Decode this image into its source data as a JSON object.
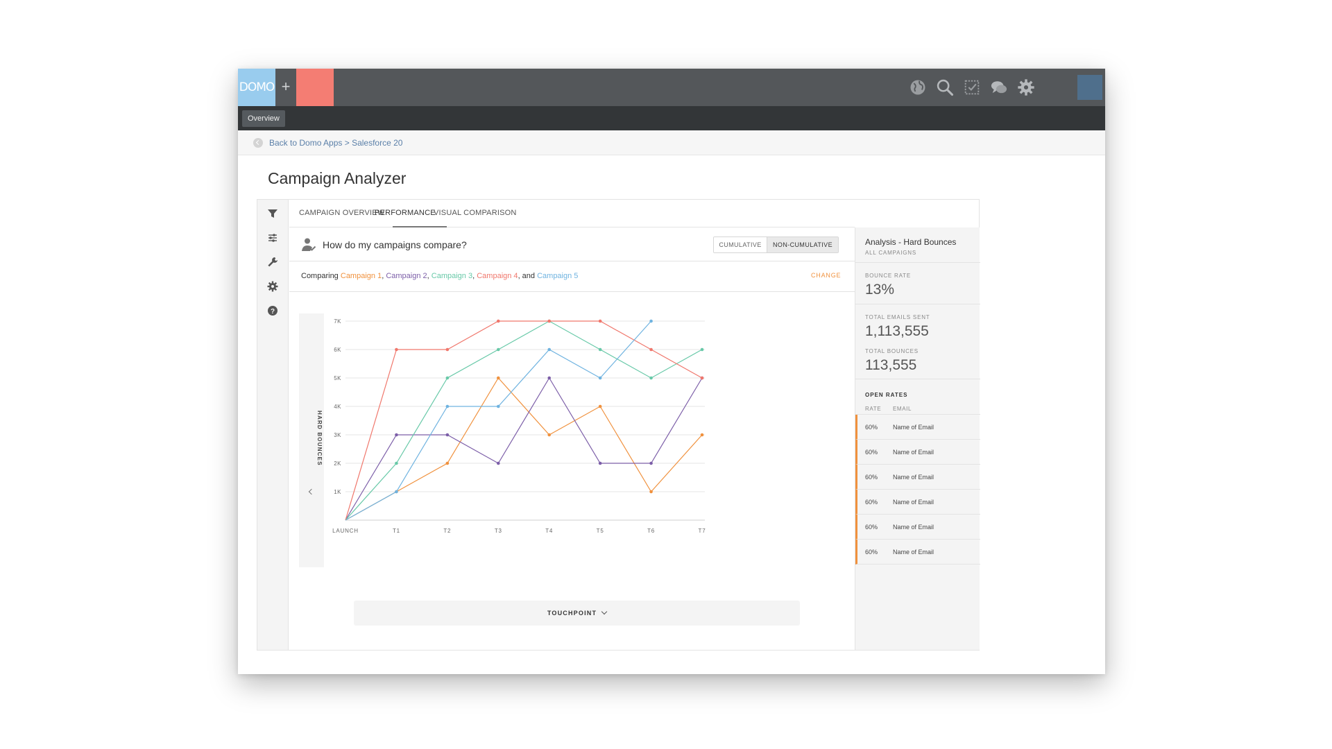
{
  "topbar": {
    "logo_text": "DOMO",
    "plus_label": "+",
    "icons": [
      "globe-icon",
      "search-icon",
      "checkbox-icon",
      "chat-icon",
      "gear-icon"
    ]
  },
  "nav": {
    "active_tab": "Overview"
  },
  "breadcrumb": {
    "text": "Back to Domo Apps > Salesforce 20"
  },
  "page": {
    "title": "Campaign Analyzer"
  },
  "left_rail": {
    "icons": [
      "filter-icon",
      "sliders-icon",
      "wrench-icon",
      "gear-icon",
      "help-icon"
    ]
  },
  "tabs": [
    {
      "label": "CAMPAIGN OVERVIEW",
      "active": false
    },
    {
      "label": "PERFORMANCE",
      "active": true
    },
    {
      "label": "VISUAL COMPARISON",
      "active": false
    }
  ],
  "question": {
    "text": "How do my campaigns compare?"
  },
  "toggle": {
    "option_left": "CUMULATIVE",
    "option_right": "NON-CUMULATIVE",
    "selected": "NON-CUMULATIVE"
  },
  "comparing": {
    "prefix": "Comparing",
    "separator": ", ",
    "and": ", and",
    "campaigns": [
      {
        "name": "Campaign 1",
        "color": "#f0913d"
      },
      {
        "name": "Campaign 2",
        "color": "#7c5ea8"
      },
      {
        "name": "Campaign 3",
        "color": "#68c9a8"
      },
      {
        "name": "Campaign 4",
        "color": "#f0776c"
      },
      {
        "name": "Campaign 5",
        "color": "#6fb3e0"
      }
    ],
    "change_label": "CHANGE"
  },
  "chart_data": {
    "type": "line",
    "x": [
      "LAUNCH",
      "T1",
      "T2",
      "T3",
      "T4",
      "T5",
      "T6",
      "T7"
    ],
    "ylabel": "HARD BOUNCES",
    "xlabel": "TOUCHPOINT",
    "ylim": [
      0,
      7000
    ],
    "yticks": [
      1000,
      2000,
      3000,
      4000,
      5000,
      6000,
      7000
    ],
    "ytick_labels": [
      "1K",
      "2K",
      "3K",
      "4K",
      "5K",
      "6K",
      "7K"
    ],
    "grid": true,
    "series": [
      {
        "color": "#f0913d",
        "values": [
          0,
          1000,
          2000,
          5000,
          3000,
          4000,
          1000,
          3000
        ]
      },
      {
        "color": "#7c5ea8",
        "values": [
          0,
          3000,
          3000,
          2000,
          5000,
          2000,
          2000,
          5000
        ]
      },
      {
        "color": "#68c9a8",
        "values": [
          0,
          2000,
          5000,
          6000,
          7000,
          6000,
          5000,
          6000
        ]
      },
      {
        "color": "#f0776c",
        "values": [
          0,
          6000,
          6000,
          7000,
          7000,
          7000,
          6000,
          5000
        ]
      },
      {
        "color": "#6fb3e0",
        "values": [
          0,
          1000,
          4000,
          4000,
          6000,
          5000,
          7000,
          null
        ]
      }
    ]
  },
  "touchpoint_button": {
    "label": "TOUCHPOINT"
  },
  "analysis": {
    "title": "Analysis - Hard Bounces",
    "subtitle": "ALL CAMPAIGNS",
    "bounce_rate_label": "BOUNCE RATE",
    "bounce_rate_value": "13%",
    "total_sent_label": "TOTAL EMAILS SENT",
    "total_sent_value": "1,113,555",
    "total_bounces_label": "TOTAL BOUNCES",
    "total_bounces_value": "113,555",
    "open_rates_header": "OPEN RATES",
    "col_rate": "RATE",
    "col_email": "EMAIL",
    "rows": [
      {
        "rate": "60%",
        "email": "Name of Email"
      },
      {
        "rate": "60%",
        "email": "Name of Email"
      },
      {
        "rate": "60%",
        "email": "Name of Email"
      },
      {
        "rate": "60%",
        "email": "Name of Email"
      },
      {
        "rate": "60%",
        "email": "Name of Email"
      },
      {
        "rate": "60%",
        "email": "Name of Email"
      }
    ]
  }
}
